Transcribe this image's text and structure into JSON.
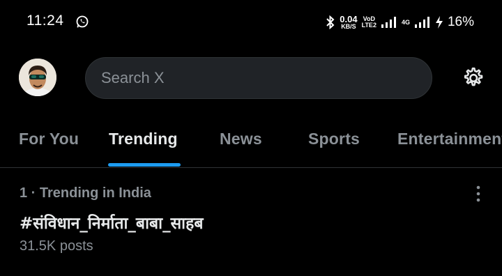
{
  "status_bar": {
    "time": "11:24",
    "net_speed": "0.04",
    "net_unit": "KB/S",
    "vo_top": "VoD",
    "vo_bottom": "LTE2",
    "net_type": "4G",
    "battery": "16%",
    "icons": [
      "whatsapp-icon",
      "bluetooth-icon",
      "signal-icon",
      "charging-icon"
    ]
  },
  "header": {
    "search_placeholder": "Search X",
    "icons": [
      "avatar",
      "gear-icon"
    ]
  },
  "tabs": [
    {
      "label": "For You",
      "active": false
    },
    {
      "label": "Trending",
      "active": true
    },
    {
      "label": "News",
      "active": false
    },
    {
      "label": "Sports",
      "active": false
    },
    {
      "label": "Entertainment",
      "active": false
    }
  ],
  "trends": [
    {
      "meta": "1 · Trending in India",
      "title": "#संविधान_निर्माता_बाबा_साहब",
      "count": "31.5K posts"
    }
  ],
  "colors": {
    "background": "#000000",
    "accent": "#1d9bf0",
    "muted_text": "#8b9197",
    "search_bg": "#202327"
  }
}
